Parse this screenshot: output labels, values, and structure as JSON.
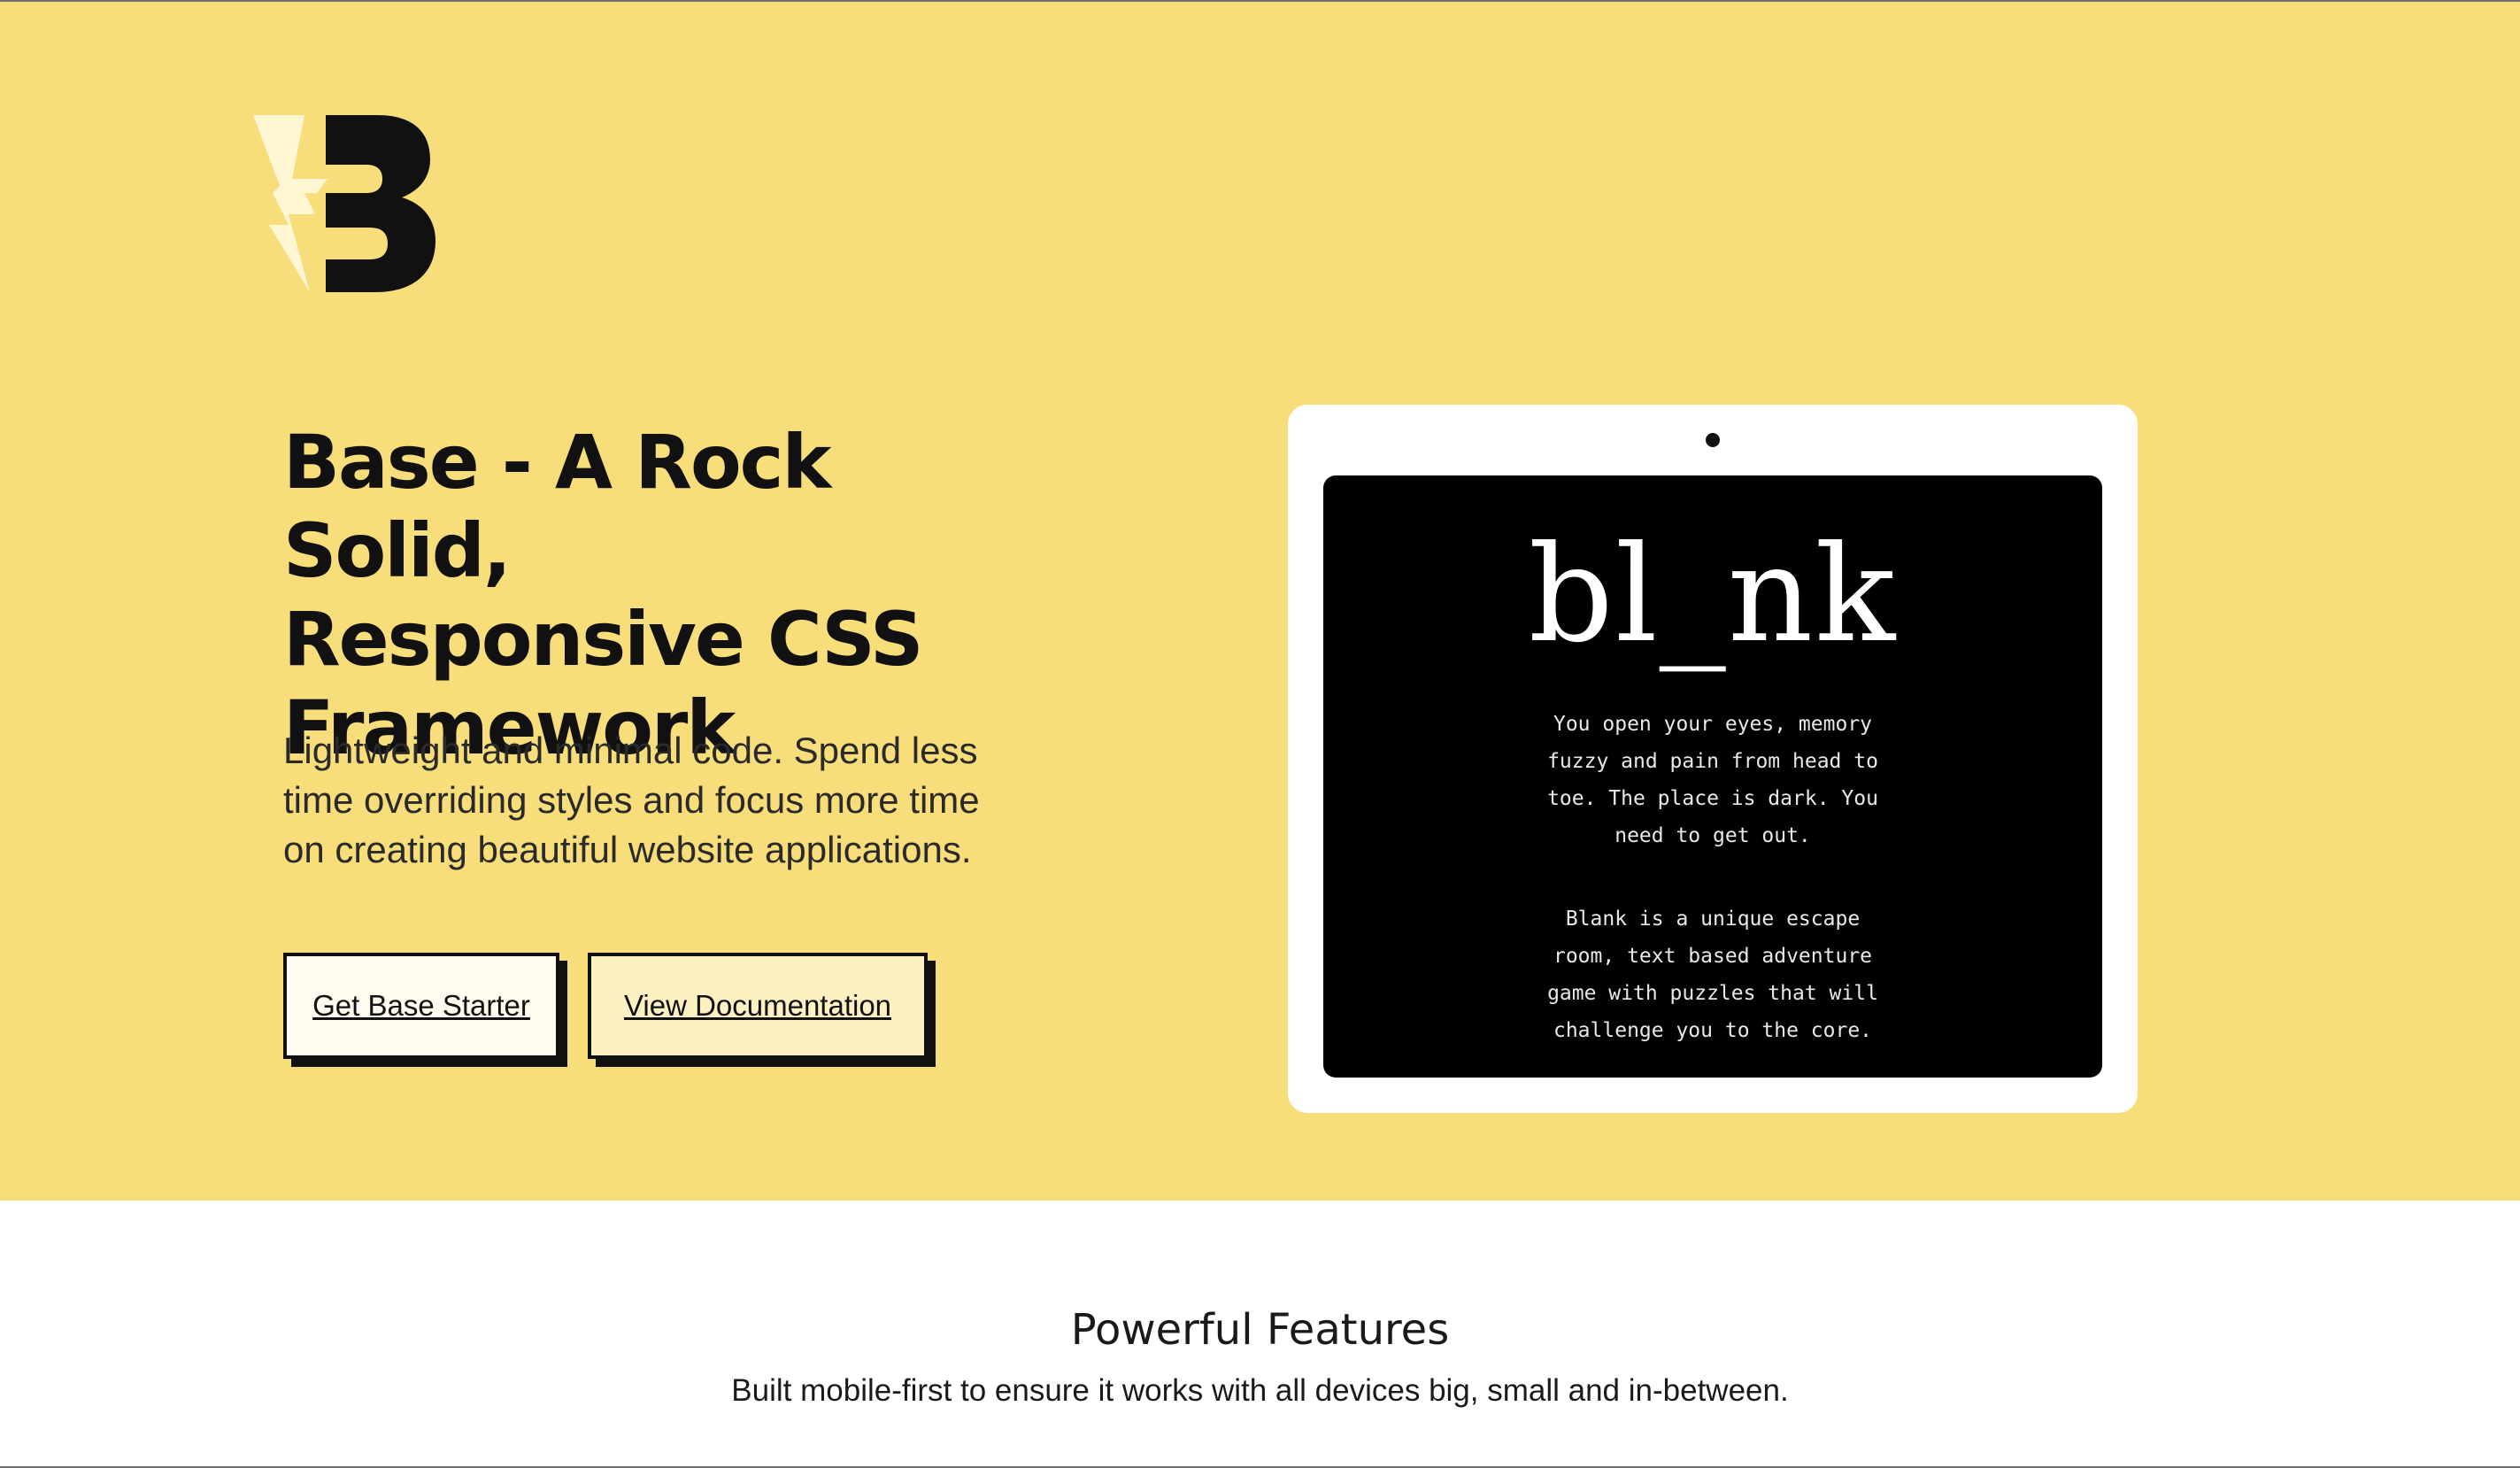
{
  "brand": {
    "logo_icon": "bolt-b-logo-icon",
    "colors": {
      "hero_background": "#f8dd7b",
      "ink": "#111111",
      "bolt": "#fff7d4",
      "button_primary_bg": "#fffbee",
      "button_secondary_bg": "#fdf0c2",
      "screen": "#000000"
    }
  },
  "hero": {
    "title_lines": [
      "Base - A Rock Solid,",
      "Responsive CSS",
      "Framework"
    ],
    "subtitle_lines": [
      "Lightweight and minimal code. Spend less",
      "time overriding styles and focus more time",
      "on creating beautiful website applications."
    ],
    "buttons": {
      "starter_label": "Get Base Starter",
      "docs_label": "View Documentation"
    }
  },
  "tablet": {
    "game_title": "bl_nk",
    "paragraph_1_lines": [
      "You open your eyes, memory",
      "fuzzy and pain from head to",
      "toe. The place is dark. You",
      "need to get out."
    ],
    "paragraph_2_lines": [
      "Blank is a unique escape",
      "room, text based adventure",
      "game with puzzles that will",
      "challenge you to the core."
    ]
  },
  "features": {
    "title": "Powerful Features",
    "subtitle": "Built mobile-first to ensure it works with all devices big, small and in-between."
  }
}
